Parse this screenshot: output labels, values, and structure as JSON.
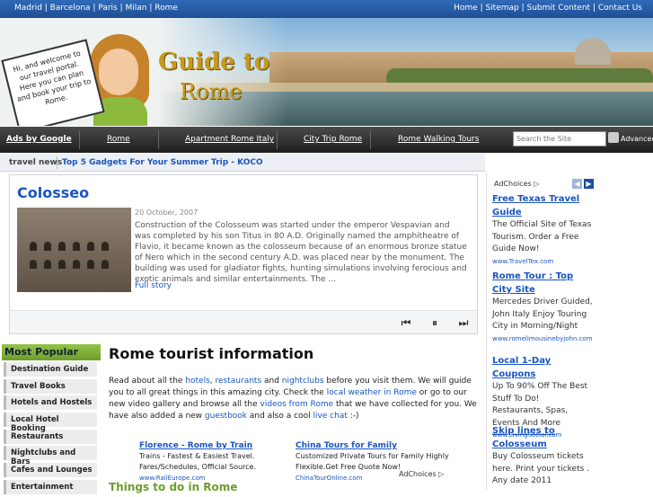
{
  "topbar": {
    "cities": "Madrid | Barcelona | Paris | Milan | Rome",
    "links": "Home | Sitemap | Submit Content | Contact Us"
  },
  "banner": {
    "sign_text": "Hi, and welcome to our travel portal. Here you can plan and book your trip to Rome.",
    "logo_line1": "Guide to",
    "logo_line2": "Rome"
  },
  "nav": {
    "ads": "Ads by Google",
    "items": [
      "Rome",
      "Apartment Rome Italy",
      "City Trip Rome",
      "Rome Walking Tours"
    ],
    "search_placeholder": "Search the Site",
    "advanced": "Advanced"
  },
  "news": {
    "label": "travel news",
    "ticker": "Top 5 Gadgets For Your Summer Trip - KOCO"
  },
  "slider": {
    "title": "Colosseo",
    "date": "20 October, 2007",
    "text": "Construction of the Colosseum was started under the emperor Vespavian and was completed by his son Titus in 80 A.D. Originally named the amphitheatre of Flavio, it became known as the colosseum because of an enormous bronze statue of Nero which in the second century A.D. was placed near by the monument. The building was used for gladiator fights, hunting simulations involving ferocious and exotic animals and similar entertainments. The ...",
    "more": "Full story",
    "controls": {
      "prev": "⏮",
      "pause": "⏸",
      "next": "⏭"
    }
  },
  "sidebar": {
    "heading": "Most Popular",
    "items": [
      "Destination Guide",
      "Travel Books",
      "Hotels and Hostels",
      "Local Hotel Booking",
      "Restaurants",
      "Nightclubs and Bars",
      "Cafes and Lounges",
      "Entertainment"
    ]
  },
  "main": {
    "heading": "Rome tourist information",
    "intro": {
      "p1": "Read about all the ",
      "l1": "hotels",
      "p2": ", ",
      "l2": "restaurants",
      "p3": " and ",
      "l3": "nightclubs",
      "p4": " before you visit them. We will guide you to all great things in this amazing city. Check the ",
      "l4": "local weather in Rome",
      "p5": " or go to our new video gallery and browse all the ",
      "l5": "videos from Rome",
      "p6": " that we have collected for you. We have also added a new ",
      "l6": "guestbook",
      "p7": " and also a cool ",
      "l7": "live chat",
      "p8": " :-)"
    },
    "ads": [
      {
        "title": "Florence - Rome by Train",
        "text": "Trains - Fastest & Easiest Travel. Fares/Schedules, Official Source.",
        "url": "www.RailEurope.com"
      },
      {
        "title": "China Tours for Family",
        "text": "Customized Private Tours for Family Highly Flexible.Get Free Quote Now!",
        "url": "ChinaTourOnline.com"
      }
    ],
    "adchoices": "AdChoices ▷",
    "subheading": "Things to do in Rome"
  },
  "right_ads": {
    "adchoices": "AdChoices ▷",
    "items": [
      {
        "title": "Free Texas Travel Guide",
        "text": "The Official Site of Texas Tourism. Order a Free Guide Now!",
        "url": "www.TravelTex.com"
      },
      {
        "title": "Rome Tour : Top City Site",
        "text": "Mercedes Driver Guided, John Italy Enjoy Touring City in Morning/Night",
        "url": "www.romelimousinebyjohn.com"
      },
      {
        "title": "Local 1-Day Coupons",
        "text": "Up To 90% Off The Best Stuff To Do! Restaurants, Spas, Events And More",
        "url": "www.LivingSocial.com"
      },
      {
        "title": "Skip lines to Colosseum",
        "text": "Buy Colosseum tickets here. Print your tickets . Any date 2011",
        "url": ""
      }
    ]
  }
}
